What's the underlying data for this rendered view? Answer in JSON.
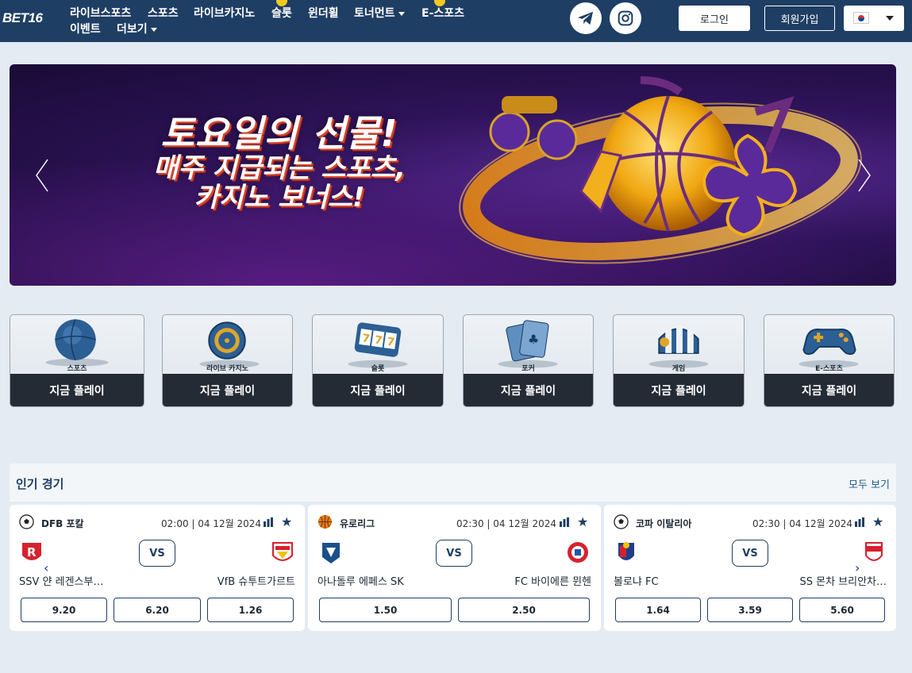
{
  "header": {
    "logo": "BET16",
    "nav": [
      {
        "label": "라이브스포츠"
      },
      {
        "label": "스포츠"
      },
      {
        "label": "라이브카지노"
      },
      {
        "label": "슬롯"
      },
      {
        "label": "윈더휠"
      },
      {
        "label": "토너먼트"
      },
      {
        "label": "E-스포츠"
      },
      {
        "label": "이벤트"
      },
      {
        "label": "더보기"
      }
    ],
    "login": "로그인",
    "signup": "회원가입"
  },
  "banner": {
    "line1": "토요일의 선물!",
    "line2": "매주 지급되는 스포츠,",
    "line3": "카지노 보너스!"
  },
  "categories": [
    {
      "label": "스포츠",
      "button": "지금 플레이",
      "icon": "basketball-icon"
    },
    {
      "label": "라이브 카지노",
      "button": "지금 플레이",
      "icon": "roulette-icon"
    },
    {
      "label": "슬롯",
      "button": "지금 플레이",
      "icon": "slot-machine-icon"
    },
    {
      "label": "포커",
      "button": "지금 플레이",
      "icon": "playing-cards-icon"
    },
    {
      "label": "게임",
      "button": "지금 플레이",
      "icon": "game-chest-icon"
    },
    {
      "label": "E-스포츠",
      "button": "지금 플레이",
      "icon": "gamepad-icon"
    }
  ],
  "popular": {
    "title": "인기 경기",
    "see_all": "모두 보기",
    "matches": [
      {
        "league": "DFB 포칼",
        "league_icon": "soccer-ball-icon",
        "time": "02:00 | 04 12월 2024",
        "vs": "VS",
        "home": "SSV 얀 레겐스부…",
        "away": "VfB 슈투트가르트",
        "odds": [
          "9.20",
          "6.20",
          "1.26"
        ]
      },
      {
        "league": "유로리그",
        "league_icon": "basketball-icon",
        "time": "02:30 | 04 12월 2024",
        "vs": "VS",
        "home": "아나돌루 에페스 SK",
        "away": "FC 바이에른 뮌헨",
        "odds": [
          "1.50",
          "2.50"
        ]
      },
      {
        "league": "코파 이탈리아",
        "league_icon": "soccer-ball-icon",
        "time": "02:30 | 04 12월 2024",
        "vs": "VS",
        "home": "볼로냐 FC",
        "away": "SS 몬차 브리안차…",
        "odds": [
          "1.64",
          "3.59",
          "5.60"
        ]
      }
    ]
  },
  "colors": {
    "header_bg": "#1f3e64",
    "page_bg": "#e4ebf2",
    "play_button_bg": "#252b35",
    "accent": "#1f3e64"
  }
}
